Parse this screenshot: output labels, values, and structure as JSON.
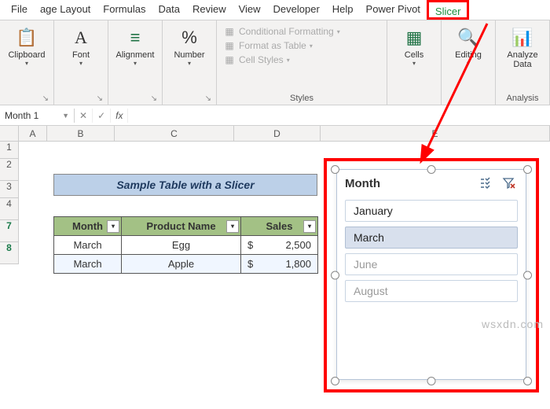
{
  "ribbon_tabs": [
    "File",
    "age Layout",
    "Formulas",
    "Data",
    "Review",
    "View",
    "Developer",
    "Help",
    "Power Pivot",
    "Slicer"
  ],
  "groups": {
    "clipboard": "Clipboard",
    "font": "Font",
    "alignment": "Alignment",
    "number": "Number",
    "styles": "Styles",
    "cells": "Cells",
    "editing": "Editing",
    "analysis": "Analysis",
    "analyze": "Analyze\nData"
  },
  "style_items": [
    "Conditional Formatting",
    "Format as Table",
    "Cell Styles"
  ],
  "namebox": "Month 1",
  "fx": "fx",
  "columns": [
    "",
    "A",
    "B",
    "C",
    "D",
    "E"
  ],
  "rows": [
    "1",
    "2",
    "3",
    "4",
    "7",
    "8"
  ],
  "title_text": "Sample Table with a Slicer",
  "table": {
    "headers": [
      "Month",
      "Product Name",
      "Sales"
    ],
    "rows": [
      {
        "month": "March",
        "product": "Egg",
        "sales": "2,500"
      },
      {
        "month": "March",
        "product": "Apple",
        "sales": "1,800"
      }
    ],
    "currency": "$"
  },
  "slicer": {
    "title": "Month",
    "options": [
      {
        "label": "January",
        "active": true,
        "selected": false
      },
      {
        "label": "March",
        "active": true,
        "selected": true
      },
      {
        "label": "June",
        "active": false,
        "selected": false
      },
      {
        "label": "August",
        "active": false,
        "selected": false
      }
    ]
  },
  "watermark": "wsxdn.com"
}
